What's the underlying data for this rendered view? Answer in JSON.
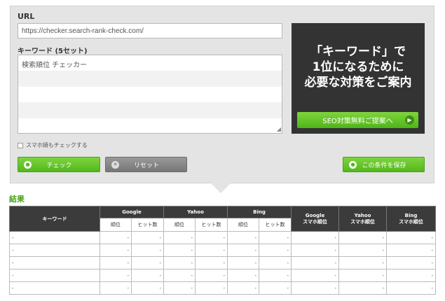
{
  "form": {
    "url_label": "URL",
    "url_value": "https://checker.search-rank-check.com/",
    "keyword_label": "キーワード (5セット)",
    "keyword_lines": [
      "検索順位 チェッカー",
      "",
      "",
      "",
      ""
    ],
    "mobile_check_label": "スマホ順もチェックする"
  },
  "buttons": {
    "check": "チェック",
    "reset": "リセット",
    "save": "この条件を保存"
  },
  "promo": {
    "line1": "「キーワード」で",
    "line2": "1位になるために",
    "line3": "必要な対策をご案内",
    "cta": "SEO対策無料ご提案へ"
  },
  "results": {
    "title": "結果",
    "columns": {
      "keyword": "キーワード",
      "google": "Google",
      "yahoo": "Yahoo",
      "bing": "Bing",
      "rank": "順位",
      "hits": "ヒット数",
      "google_mobile_1": "Google",
      "google_mobile_2": "スマホ順位",
      "yahoo_mobile_1": "Yahoo",
      "yahoo_mobile_2": "スマホ順位",
      "bing_mobile_1": "Bing",
      "bing_mobile_2": "スマホ順位"
    },
    "rows": [
      [
        "-",
        "-",
        "-",
        "-",
        "-",
        "-",
        "-",
        "-",
        "-",
        "-"
      ],
      [
        "-",
        "-",
        "-",
        "-",
        "-",
        "-",
        "-",
        "-",
        "-",
        "-"
      ],
      [
        "-",
        "-",
        "-",
        "-",
        "-",
        "-",
        "-",
        "-",
        "-",
        "-"
      ],
      [
        "-",
        "-",
        "-",
        "-",
        "-",
        "-",
        "-",
        "-",
        "-",
        "-"
      ],
      [
        "-",
        "-",
        "-",
        "-",
        "-",
        "-",
        "-",
        "-",
        "-",
        "-"
      ]
    ]
  },
  "colors": {
    "accent_green": "#53b81c",
    "title_green": "#4aa31a",
    "dark_header": "#3b3b3b",
    "panel_bg": "#e4e4e4"
  }
}
